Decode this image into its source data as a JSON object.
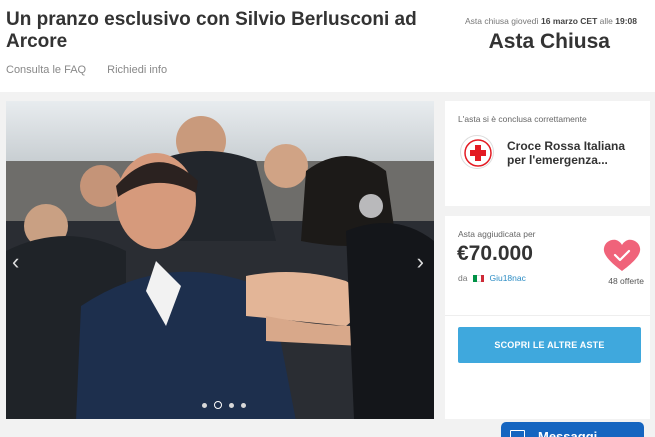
{
  "header": {
    "title": "Un pranzo esclusivo con Silvio Berlusconi ad Arcore",
    "faq_link": "Consulta le FAQ",
    "info_link": "Richiedi info",
    "closing_prefix": "Asta chiusa giovedì",
    "closing_date": "16 marzo CET",
    "closing_mid": "alle",
    "closing_time": "19:08",
    "status": "Asta Chiusa"
  },
  "gallery": {
    "prev_icon": "chevron-left-icon",
    "next_icon": "chevron-right-icon",
    "slide_count": 4,
    "active_index": 1
  },
  "charity": {
    "note": "L'asta si è conclusa correttamente",
    "name": "Croce Rossa Italiana per l'emergenza...",
    "logo_color": "#e31b23"
  },
  "award": {
    "label": "Asta aggiudicata per",
    "amount": "€70.000",
    "winner_prefix": "da",
    "winner_name": "Giu18nac",
    "offers": "48 offerte",
    "heart_color": "#f0637a",
    "flag_colors": [
      "#009246",
      "#ffffff",
      "#ce2b37"
    ]
  },
  "cta": {
    "label": "SCOPRI LE ALTRE ASTE",
    "color": "#3fa8dd"
  },
  "messages": {
    "label": "Messaggi"
  }
}
